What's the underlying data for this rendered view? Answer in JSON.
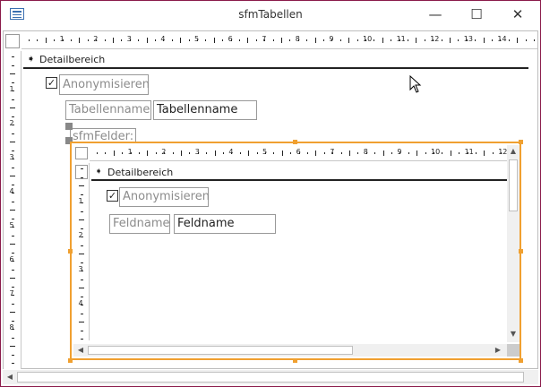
{
  "window": {
    "title": "sfmTabellen",
    "minimize": "—",
    "maximize": "☐",
    "close": "✕"
  },
  "outer": {
    "section_label": "Detailbereich",
    "checkbox_mark": "✓",
    "anonymisieren_label": "Anonymisieren",
    "tabellenname_label": "Tabellenname",
    "tabellenname_value": "Tabellenname",
    "subform_label": "sfmFelder:",
    "ruler_h_labels": [
      "1",
      "2",
      "3",
      "4",
      "5",
      "6",
      "7",
      "8",
      "9",
      "10",
      "11",
      "12",
      "13",
      "14"
    ],
    "ruler_v_labels": [
      "1",
      "2",
      "3",
      "4",
      "5",
      "6",
      "7",
      "8"
    ]
  },
  "inner": {
    "section_label": "Detailbereich",
    "checkbox_mark": "✓",
    "anonymisieren_label": "Anonymisieren",
    "feldname_label": "Feldname",
    "feldname_value": "Feldname",
    "ruler_h_labels": [
      "1",
      "2",
      "3",
      "4",
      "5",
      "6",
      "7",
      "8",
      "9",
      "10",
      "11",
      "12"
    ],
    "ruler_v_labels": [
      "1",
      "2",
      "3",
      "4"
    ]
  },
  "scroll": {
    "left": "◀",
    "right": "▶",
    "up": "▲",
    "down": "▼"
  },
  "colors": {
    "selection": "#f0a030",
    "window_border": "#8a1a4a"
  }
}
